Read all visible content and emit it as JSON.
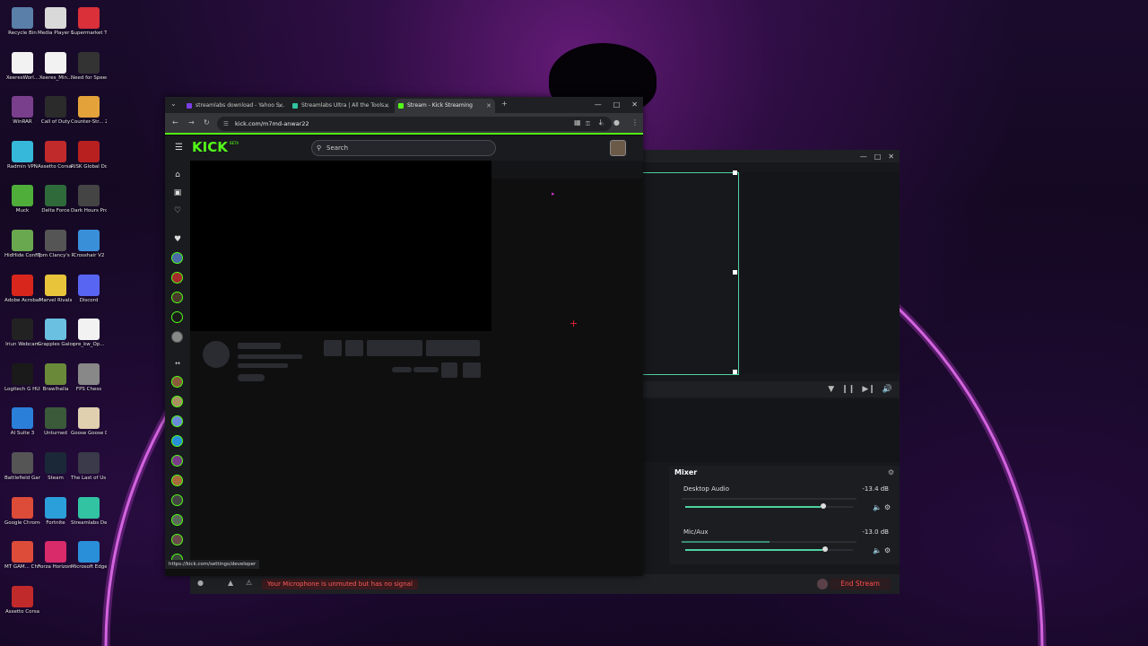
{
  "desktop": {
    "icons": [
      {
        "label": "Recycle Bin",
        "icon": "recycle-bin-icon",
        "color": "#5a7fa8"
      },
      {
        "label": "Media Player Classic",
        "icon": "media-player-icon",
        "color": "#d9d9d9"
      },
      {
        "label": "Supermarket Together",
        "icon": "supermarket-icon",
        "color": "#d9303a"
      },
      {
        "label": "XeeresWorl...",
        "icon": "java-icon",
        "color": "#f2f2f2"
      },
      {
        "label": "Xeeres_Min...",
        "icon": "java-icon",
        "color": "#f2f2f2"
      },
      {
        "label": "Need for Speed - Mo...",
        "icon": "nfs-icon",
        "color": "#333333"
      },
      {
        "label": "WinRAR",
        "icon": "winrar-icon",
        "color": "#7a3f8c"
      },
      {
        "label": "Call of Duty",
        "icon": "cod-icon",
        "color": "#2b2b2b"
      },
      {
        "label": "Counter-Str... 2",
        "icon": "cs-icon",
        "color": "#e3a33a"
      },
      {
        "label": "Radmin VPN",
        "icon": "radmin-icon",
        "color": "#35b8d9"
      },
      {
        "label": "Assetto Corsa Com...",
        "icon": "assetto-icon",
        "color": "#c12a2a"
      },
      {
        "label": "RISK Global Domination",
        "icon": "risk-icon",
        "color": "#b82020"
      },
      {
        "label": "Muck",
        "icon": "muck-icon",
        "color": "#4fae3a"
      },
      {
        "label": "Delta Force",
        "icon": "delta-force-icon",
        "color": "#2f6a3a"
      },
      {
        "label": "Dark Hours Prologue",
        "icon": "dark-hours-icon",
        "color": "#444444"
      },
      {
        "label": "HidHide Configurat...",
        "icon": "hidhide-icon",
        "color": "#6aa84f"
      },
      {
        "label": "Tom Clancy's Rainbow Si...",
        "icon": "rainbow-six-icon",
        "color": "#555555"
      },
      {
        "label": "Crosshair V2",
        "icon": "crosshair-icon",
        "color": "#3a8fd9"
      },
      {
        "label": "Adobe Acrobat",
        "icon": "acrobat-icon",
        "color": "#d9261c"
      },
      {
        "label": "Marvel Rivals",
        "icon": "marvel-rivals-icon",
        "color": "#e8c43a"
      },
      {
        "label": "Discord",
        "icon": "discord-icon",
        "color": "#5865f2"
      },
      {
        "label": "Iriun Webcam",
        "icon": "iriun-icon",
        "color": "#222222"
      },
      {
        "label": "Grapples Galore",
        "icon": "grapples-icon",
        "color": "#6ac0e0"
      },
      {
        "label": "pre_kw_Op...",
        "icon": "java-icon",
        "color": "#f2f2f2"
      },
      {
        "label": "Logitech G HUB",
        "icon": "ghub-icon",
        "color": "#1a1a1a"
      },
      {
        "label": "Brawlhalla",
        "icon": "brawlhalla-icon",
        "color": "#6a8a3a"
      },
      {
        "label": "FPS Chess",
        "icon": "fps-chess-icon",
        "color": "#888888"
      },
      {
        "label": "AI Suite 3",
        "icon": "ai-suite-icon",
        "color": "#2a7fd9"
      },
      {
        "label": "Unturned",
        "icon": "unturned-icon",
        "color": "#3a5a3a"
      },
      {
        "label": "Goose Goose Duck",
        "icon": "goose-icon",
        "color": "#e0d0b0"
      },
      {
        "label": "Battlefield Games...",
        "icon": "battlefield-icon",
        "color": "#555555"
      },
      {
        "label": "Steam",
        "icon": "steam-icon",
        "color": "#1b2838"
      },
      {
        "label": "The Last of Us - Part I...",
        "icon": "tlou-icon",
        "color": "#3a3a4a"
      },
      {
        "label": "Google Chrome",
        "icon": "chrome-icon",
        "color": "#dd4b39"
      },
      {
        "label": "Fortnite",
        "icon": "fortnite-icon",
        "color": "#2a9fd9"
      },
      {
        "label": "Streamlabs Desktop",
        "icon": "streamlabs-icon",
        "color": "#31c3a2"
      },
      {
        "label": "MT GAM... Chrome",
        "icon": "chrome-icon",
        "color": "#dd4b39"
      },
      {
        "label": "Forza Horizon 5",
        "icon": "forza-icon",
        "color": "#d92a6a"
      },
      {
        "label": "Microsoft Edge",
        "icon": "edge-icon",
        "color": "#2a8fd9"
      },
      {
        "label": "Assetto Corsa",
        "icon": "assetto-icon",
        "color": "#c12a2a"
      }
    ]
  },
  "browser": {
    "tabs": [
      {
        "label": "streamlabs download - Yahoo S...",
        "favicon_color": "#7b3fe4"
      },
      {
        "label": "Streamlabs Ultra | All the Tools...",
        "favicon_color": "#31c3a2"
      },
      {
        "label": "Stream - Kick Streaming",
        "favicon_color": "#53fc18"
      }
    ],
    "url": "kick.com/m7md-anwar22",
    "status_url": "https://kick.com/settings/developer"
  },
  "kick": {
    "logo": "KICK",
    "beta": "BETA",
    "search_placeholder": "Search"
  },
  "streamlabs": {
    "mixer_title": "Mixer",
    "channels": [
      {
        "name": "Desktop Audio",
        "db": "-13.4 dB",
        "level": 0.81
      },
      {
        "name": "Mic/Aux",
        "db": "-13.0 dB",
        "level": 0.82
      }
    ],
    "mic_warning": "Your Microphone is unmuted but has no signal",
    "end_stream": "End Stream"
  },
  "colors": {
    "kick_green": "#53fc18",
    "streamlabs_teal": "#4fd1a0",
    "end_stream_red": "#ff4d4d"
  }
}
